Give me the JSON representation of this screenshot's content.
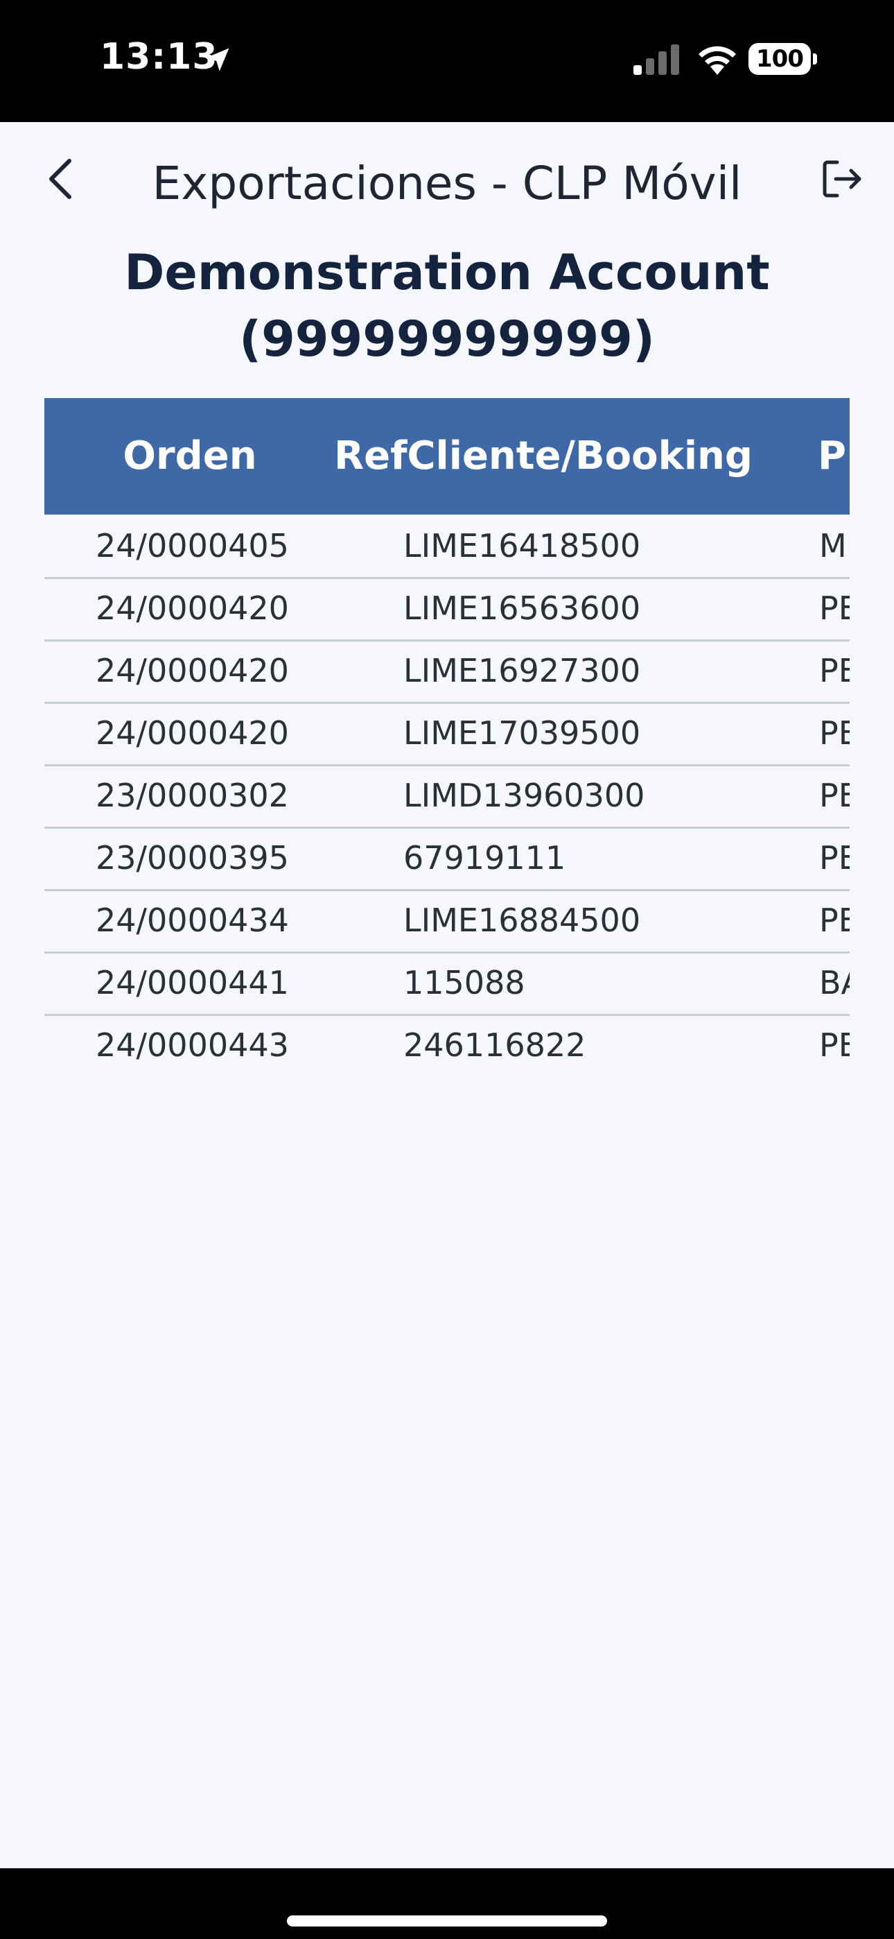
{
  "status_bar": {
    "time": "13:13",
    "battery": "100"
  },
  "nav": {
    "title": "Exportaciones - CLP Móvil"
  },
  "account": {
    "name": "Demonstration Account",
    "id": "(99999999999)"
  },
  "table": {
    "columns": [
      "Orden",
      "Ref Cliente/Booking",
      "PE"
    ],
    "rows": [
      {
        "orden": "24/0000405",
        "ref": "LIME16418500",
        "third": "M"
      },
      {
        "orden": "24/0000420",
        "ref": "LIME16563600",
        "third": "PE"
      },
      {
        "orden": "24/0000420",
        "ref": "LIME16927300",
        "third": "PE"
      },
      {
        "orden": "24/0000420",
        "ref": "LIME17039500",
        "third": "PE"
      },
      {
        "orden": "23/0000302",
        "ref": "LIMD13960300",
        "third": "PE"
      },
      {
        "orden": "23/0000395",
        "ref": "67919111",
        "third": "PE"
      },
      {
        "orden": "24/0000434",
        "ref": "LIME16884500",
        "third": "PE"
      },
      {
        "orden": "24/0000441",
        "ref": "115088",
        "third": "BA"
      },
      {
        "orden": "24/0000443",
        "ref": "246116822",
        "third": "PE"
      }
    ]
  },
  "colors": {
    "header_bg": "#3f69a6",
    "page_bg": "#f6f7fd",
    "title_text": "#14243e"
  },
  "icons": {
    "back": "chevron-left-icon",
    "logout": "logout-icon"
  }
}
